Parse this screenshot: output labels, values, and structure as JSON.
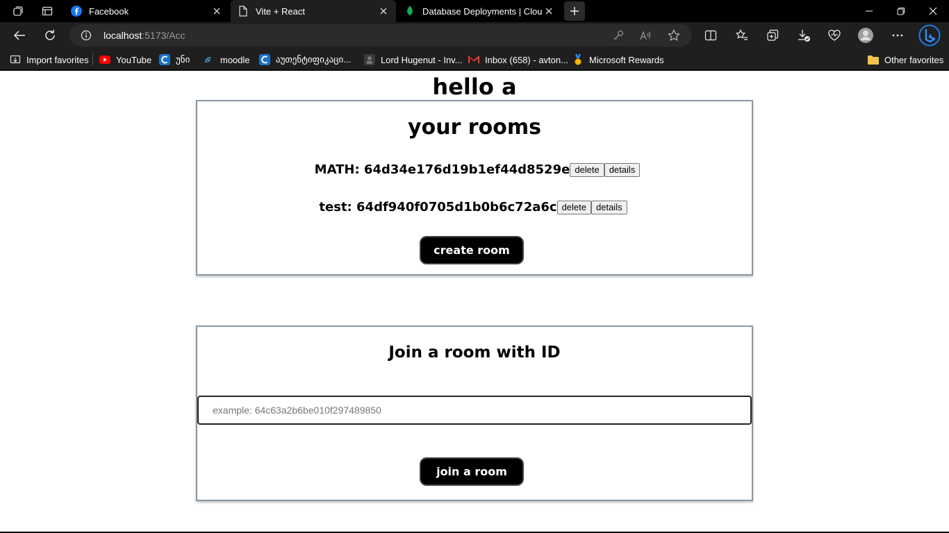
{
  "tabs": [
    {
      "title": "Facebook",
      "icon": "facebook-icon",
      "active": false
    },
    {
      "title": "Vite + React",
      "icon": "page-icon",
      "active": true
    },
    {
      "title": "Database Deployments | Cloud: M",
      "icon": "mongodb-icon",
      "active": false
    }
  ],
  "address": {
    "host": "localhost",
    "path": ":5173/Acc"
  },
  "bookmarks": [
    {
      "label": "Import favorites",
      "icon": "import-icon"
    },
    {
      "label": "YouTube",
      "icon": "youtube-icon"
    },
    {
      "label": "უნი",
      "icon": "uni-icon"
    },
    {
      "label": "moodle",
      "icon": "moodle-icon"
    },
    {
      "label": "აუთენტიფიკაცი...",
      "icon": "auth-icon"
    },
    {
      "label": "Lord Hugenut - Inv...",
      "icon": "steam-icon"
    },
    {
      "label": "Inbox (658) - avton...",
      "icon": "gmail-icon"
    },
    {
      "label": "Microsoft Rewards",
      "icon": "rewards-icon"
    },
    {
      "label": "Other favorites",
      "icon": "folder-icon"
    }
  ],
  "page": {
    "greeting": "hello a",
    "rooms_title": "your rooms",
    "rooms": [
      {
        "label": "MATH: 64d34e176d19b1ef44d8529e",
        "delete": "delete",
        "details": "details"
      },
      {
        "label": "test: 64df940f0705d1b0b6c72a6c",
        "delete": "delete",
        "details": "details"
      }
    ],
    "create_button": "create room",
    "join_title": "Join a room with ID",
    "join_placeholder": "example: 64c63a2b6be010f297489850",
    "join_button": "join a room"
  },
  "colors": {
    "brand_facebook": "#1877f2",
    "youtube_red": "#ff0000",
    "edge_blue": "#1e7ae6",
    "mongodb_green": "#13aa52"
  }
}
